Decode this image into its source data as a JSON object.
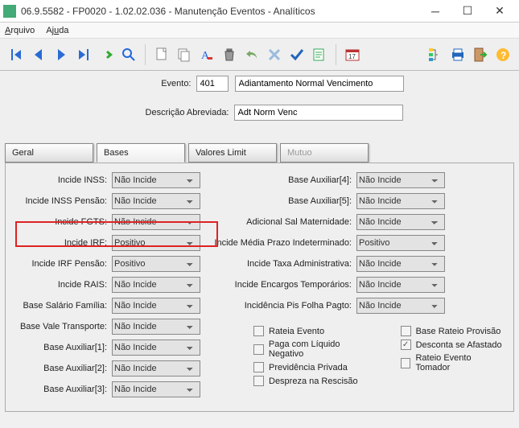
{
  "window": {
    "title": "06.9.5582 - FP0020 - 1.02.02.036 - Manutenção Eventos - Analíticos"
  },
  "menu": {
    "arquivo": "Arquivo",
    "ajuda": "Ajuda"
  },
  "header": {
    "evento_label": "Evento:",
    "evento_code": "401",
    "evento_desc": "Adiantamento Normal Vencimento",
    "descr_label": "Descrição Abreviada:",
    "descr_value": "Adt Norm Venc"
  },
  "tabs": {
    "geral": "Geral",
    "bases": "Bases",
    "valores": "Valores Limit",
    "mutuo": "Mutuo"
  },
  "labels_left": {
    "inss": "Incide INSS:",
    "inss_pensao": "Incide INSS Pensão:",
    "fgts": "Incide FGTS:",
    "irf": "Incide IRF:",
    "irf_pensao": "Incide IRF Pensão:",
    "rais": "Incide RAIS:",
    "salfam": "Base Salário Família:",
    "valetr": "Base Vale Transporte:",
    "aux1": "Base Auxiliar[1]:",
    "aux2": "Base Auxiliar[2]:",
    "aux3": "Base Auxiliar[3]:"
  },
  "values_left": {
    "inss": "Não Incide",
    "inss_pensao": "Não Incide",
    "fgts": "Não Incide",
    "irf": "Positivo",
    "irf_pensao": "Positivo",
    "rais": "Não Incide",
    "salfam": "Não Incide",
    "valetr": "Não Incide",
    "aux1": "Não Incide",
    "aux2": "Não Incide",
    "aux3": "Não Incide"
  },
  "labels_right": {
    "aux4": "Base Auxiliar[4]:",
    "aux5": "Base Auxiliar[5]:",
    "adicmat": "Adicional Sal Maternidade:",
    "mediaprazo": "Incide Média Prazo Indeterminado:",
    "taxaadm": "Incide Taxa Administrativa:",
    "encargos": "Incide Encargos Temporários:",
    "pisfolha": "Incidência Pis Folha Pagto:"
  },
  "values_right": {
    "aux4": "Não Incide",
    "aux5": "Não Incide",
    "adicmat": "Não Incide",
    "mediaprazo": "Positivo",
    "taxaadm": "Não Incide",
    "encargos": "Não Incide",
    "pisfolha": "Não Incide"
  },
  "checks": {
    "rateia": "Rateia Evento",
    "liquido": "Paga com Líquido Negativo",
    "prevpriv": "Previdência Privada",
    "despreza": "Despreza na Rescisão",
    "provprov": "Base Rateio Provisão",
    "desconta": "Desconta se Afastado",
    "tomador": "Rateio Evento Tomador"
  }
}
